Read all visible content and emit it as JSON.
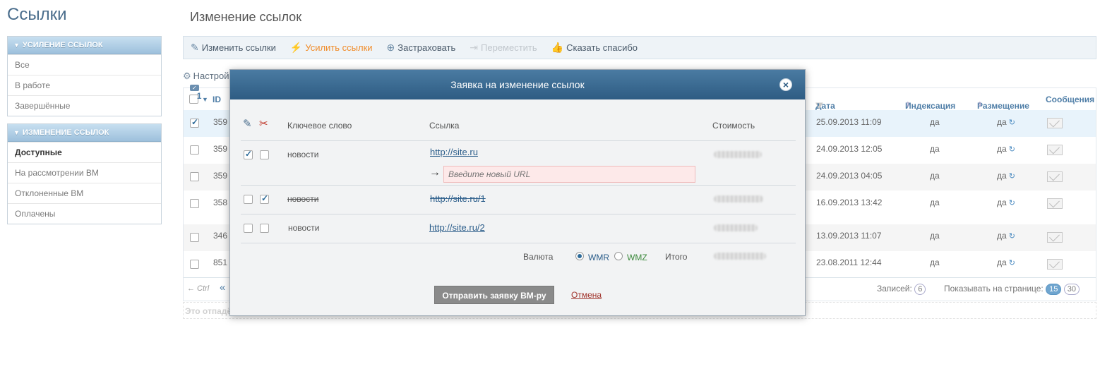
{
  "site_title": "Ссылки",
  "sidebar": {
    "panel1": {
      "title": "Усиление ссылок",
      "items": [
        "Все",
        "В работе",
        "Завершённые"
      ]
    },
    "panel2": {
      "title": "Изменение ссылок",
      "items": [
        "Доступные",
        "На рассмотрении ВМ",
        "Отклоненные ВМ",
        "Оплачены"
      ],
      "active": 0
    }
  },
  "page_title": "Изменение ссылок",
  "toolbar": {
    "change": "Изменить ссылки",
    "boost": "Усилить ссылки",
    "insure": "Застраховать",
    "move": "Переместить",
    "thanks": "Сказать спасибо"
  },
  "settings_label": "Настрой",
  "badge_count": "1",
  "grid": {
    "headers": {
      "id": "ID",
      "date": "Дата",
      "indexing": "Индексация",
      "placement": "Размещение",
      "messages": "Сообщения"
    },
    "rows": [
      {
        "id": "359",
        "date": "25.09.2013 11:09",
        "indexing": "да",
        "placement": "да",
        "checked": true
      },
      {
        "id": "359",
        "date": "24.09.2013 12:05",
        "indexing": "да",
        "placement": "да",
        "checked": false
      },
      {
        "id": "359",
        "date": "24.09.2013 04:05",
        "indexing": "да",
        "placement": "да",
        "checked": false
      },
      {
        "id": "358",
        "date": "16.09.2013 13:42",
        "indexing": "да",
        "placement": "да",
        "checked": false
      },
      {
        "id": "346",
        "date": "13.09.2013 11:07",
        "indexing": "да",
        "placement": "да",
        "checked": false
      },
      {
        "id": "851",
        "date": "23.08.2011 12:44",
        "indexing": "да",
        "placement": "да",
        "checked": false
      }
    ],
    "footer": {
      "ctrl": "← Ctrl",
      "prev": "«",
      "records_label": "Записей:",
      "records_count": "6",
      "per_page_label": "Показывать на странице:",
      "per_page_options": [
        "15",
        "30"
      ],
      "per_page_selected": "15"
    }
  },
  "note": "Это отпадё",
  "modal": {
    "title": "Заявка на изменение ссылок",
    "headers": {
      "keyword": "Ключевое слово",
      "link": "Ссылка",
      "cost": "Стоимость"
    },
    "rows": [
      {
        "keyword": "новости",
        "link": "http://site.ru",
        "cb1": true,
        "cb2": false,
        "struck": false
      },
      {
        "keyword": "новости",
        "link": "http://site.ru/1",
        "cb1": false,
        "cb2": true,
        "struck": true
      },
      {
        "keyword": "новости",
        "link": "http://site.ru/2",
        "cb1": false,
        "cb2": false,
        "struck": false
      }
    ],
    "new_url_placeholder": "Введите новый URL",
    "currency_label": "Валюта",
    "currency_options": [
      "WMR",
      "WMZ"
    ],
    "currency_selected": "WMR",
    "total_label": "Итого",
    "submit": "Отправить заявку ВМ-ру",
    "cancel": "Отмена"
  }
}
